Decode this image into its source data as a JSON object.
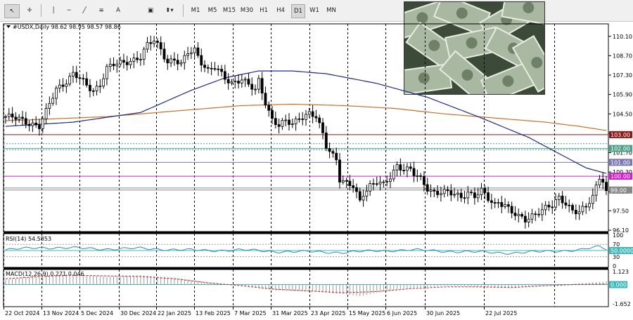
{
  "toolbar": {
    "timeframes": [
      "M1",
      "M5",
      "M15",
      "M30",
      "H1",
      "H4",
      "D1",
      "W1",
      "MN"
    ],
    "active": "D1"
  },
  "header": {
    "symbol": "#USDX,Daily",
    "ohlc": "98.62 98.95 98.57 98.86"
  },
  "photo": {
    "subject": "dollar-bills-photo"
  },
  "chart_data": [
    {
      "type": "candlestick",
      "ylim": [
        96.0,
        111.0
      ],
      "yticks": [
        "110.10",
        "108.70",
        "107.30",
        "105.90",
        "104.50",
        "103.10",
        "101.70",
        "100.30",
        "98.90",
        "97.50",
        "96.10"
      ],
      "xticks": [
        "22 Oct 2024",
        "13 Nov 2024",
        "5 Dec 2024",
        "30 Dec 2024",
        "22 Jan 2025",
        "13 Feb 2025",
        "7 Mar 2025",
        "31 Mar 2025",
        "23 Apr 2025",
        "15 May 2025",
        "6 Jun 2025",
        "30 Jun 2025",
        "22 Jul 2025"
      ],
      "close_path": [
        [
          0,
          104.3
        ],
        [
          4,
          104.1
        ],
        [
          8,
          103.8
        ],
        [
          10,
          103.6
        ],
        [
          12,
          104.6
        ],
        [
          15,
          106.3
        ],
        [
          18,
          106.9
        ],
        [
          20,
          107.4
        ],
        [
          22,
          107.0
        ],
        [
          24,
          106.5
        ],
        [
          26,
          106.2
        ],
        [
          28,
          106.7
        ],
        [
          30,
          107.8
        ],
        [
          32,
          108.0
        ],
        [
          35,
          108.2
        ],
        [
          37,
          108.4
        ],
        [
          40,
          108.6
        ],
        [
          42,
          109.4
        ],
        [
          44,
          109.8
        ],
        [
          46,
          109.2
        ],
        [
          48,
          108.3
        ],
        [
          50,
          108.4
        ],
        [
          52,
          108.0
        ],
        [
          54,
          108.9
        ],
        [
          56,
          109.2
        ],
        [
          58,
          108.3
        ],
        [
          60,
          107.6
        ],
        [
          62,
          107.8
        ],
        [
          65,
          107.1
        ],
        [
          67,
          106.8
        ],
        [
          70,
          107.0
        ],
        [
          72,
          106.5
        ],
        [
          74,
          106.2
        ],
        [
          75,
          106.9
        ],
        [
          77,
          105.4
        ],
        [
          79,
          104.1
        ],
        [
          81,
          103.6
        ],
        [
          83,
          103.9
        ],
        [
          85,
          103.8
        ],
        [
          87,
          104.3
        ],
        [
          90,
          104.5
        ],
        [
          92,
          104.2
        ],
        [
          94,
          103.0
        ],
        [
          95,
          102.2
        ],
        [
          96,
          101.9
        ],
        [
          98,
          101.3
        ],
        [
          99,
          99.8
        ],
        [
          101,
          99.4
        ],
        [
          103,
          99.2
        ],
        [
          105,
          98.2
        ],
        [
          106,
          98.8
        ],
        [
          108,
          99.4
        ],
        [
          110,
          99.6
        ],
        [
          112,
          99.3
        ],
        [
          114,
          99.9
        ],
        [
          116,
          100.8
        ],
        [
          118,
          100.6
        ],
        [
          120,
          100.5
        ],
        [
          121,
          100.1
        ],
        [
          123,
          99.7
        ],
        [
          125,
          99.1
        ],
        [
          127,
          98.9
        ],
        [
          129,
          98.9
        ],
        [
          131,
          98.8
        ],
        [
          133,
          98.6
        ],
        [
          135,
          98.5
        ],
        [
          137,
          98.9
        ],
        [
          139,
          98.6
        ],
        [
          141,
          98.9
        ],
        [
          143,
          98.3
        ],
        [
          145,
          97.9
        ],
        [
          146,
          98.2
        ],
        [
          148,
          98.0
        ],
        [
          150,
          97.4
        ],
        [
          152,
          97.0
        ],
        [
          154,
          96.8
        ],
        [
          156,
          97.2
        ],
        [
          158,
          97.5
        ],
        [
          160,
          97.7
        ],
        [
          162,
          97.8
        ],
        [
          164,
          98.4
        ],
        [
          166,
          98.1
        ],
        [
          168,
          97.6
        ],
        [
          170,
          97.4
        ],
        [
          172,
          97.7
        ],
        [
          174,
          98.5
        ],
        [
          176,
          100.0
        ],
        [
          177,
          99.8
        ],
        [
          178,
          98.9
        ]
      ],
      "ma_blue": [
        [
          0,
          103.6
        ],
        [
          20,
          103.9
        ],
        [
          40,
          104.6
        ],
        [
          55,
          106.2
        ],
        [
          65,
          107.1
        ],
        [
          75,
          107.6
        ],
        [
          85,
          107.6
        ],
        [
          95,
          107.4
        ],
        [
          110,
          106.7
        ],
        [
          125,
          105.7
        ],
        [
          140,
          104.3
        ],
        [
          155,
          102.8
        ],
        [
          165,
          101.5
        ],
        [
          172,
          100.6
        ],
        [
          178,
          100.2
        ]
      ],
      "ma_orange": [
        [
          0,
          104.0
        ],
        [
          30,
          104.3
        ],
        [
          50,
          104.7
        ],
        [
          70,
          105.1
        ],
        [
          85,
          105.2
        ],
        [
          100,
          105.1
        ],
        [
          115,
          104.9
        ],
        [
          130,
          104.5
        ],
        [
          145,
          104.2
        ],
        [
          160,
          103.9
        ],
        [
          170,
          103.6
        ],
        [
          178,
          103.3
        ]
      ],
      "levels": [
        {
          "value": 103.0,
          "label": "103.00",
          "color": "#8b1a1a"
        },
        {
          "value": 102.0,
          "label": "102.00",
          "color": "#4fa08a"
        },
        {
          "value": 101.0,
          "label": "101.00",
          "color": "#7a7ab0"
        },
        {
          "value": 100.0,
          "label": "100.00",
          "color": "#d020d0"
        },
        {
          "value": 99.0,
          "label": "99.00",
          "color": "#888888"
        }
      ]
    },
    {
      "type": "line",
      "title": "RSI(14) 54.5853",
      "ylim": [
        0,
        100
      ],
      "yticks": [
        "100",
        "70",
        "50",
        "30",
        "0"
      ],
      "level_label": "50.0000",
      "values": [
        [
          0,
          52
        ],
        [
          10,
          60
        ],
        [
          20,
          58
        ],
        [
          30,
          55
        ],
        [
          40,
          57
        ],
        [
          50,
          53
        ],
        [
          60,
          50
        ],
        [
          70,
          52
        ],
        [
          80,
          47
        ],
        [
          90,
          46
        ],
        [
          100,
          44
        ],
        [
          110,
          49
        ],
        [
          120,
          52
        ],
        [
          130,
          48
        ],
        [
          140,
          45
        ],
        [
          150,
          42
        ],
        [
          160,
          47
        ],
        [
          170,
          52
        ],
        [
          176,
          62
        ],
        [
          178,
          55
        ]
      ]
    },
    {
      "type": "histogram",
      "title": "MACD(12,26,9) 0.271 0.046",
      "ylim": [
        -1.9,
        1.3
      ],
      "yticks": [
        "1.123",
        "0.000",
        "-1.652"
      ],
      "level_label": "0.000",
      "values": [
        [
          0,
          0.4
        ],
        [
          10,
          0.8
        ],
        [
          20,
          0.9
        ],
        [
          30,
          0.7
        ],
        [
          40,
          0.8
        ],
        [
          50,
          0.6
        ],
        [
          60,
          0.2
        ],
        [
          70,
          -0.1
        ],
        [
          80,
          -0.5
        ],
        [
          90,
          -0.6
        ],
        [
          100,
          -0.8
        ],
        [
          105,
          -1.0
        ],
        [
          110,
          -0.7
        ],
        [
          120,
          -0.3
        ],
        [
          130,
          -0.1
        ],
        [
          140,
          -0.2
        ],
        [
          150,
          -0.3
        ],
        [
          160,
          -0.1
        ],
        [
          170,
          0.1
        ],
        [
          178,
          0.27
        ]
      ],
      "signal": [
        [
          0,
          0.5
        ],
        [
          10,
          0.7
        ],
        [
          20,
          0.8
        ],
        [
          30,
          0.75
        ],
        [
          40,
          0.7
        ],
        [
          50,
          0.5
        ],
        [
          60,
          0.15
        ],
        [
          70,
          -0.1
        ],
        [
          80,
          -0.4
        ],
        [
          90,
          -0.55
        ],
        [
          100,
          -0.7
        ],
        [
          110,
          -0.6
        ],
        [
          120,
          -0.35
        ],
        [
          130,
          -0.2
        ],
        [
          140,
          -0.2
        ],
        [
          150,
          -0.25
        ],
        [
          160,
          -0.1
        ],
        [
          170,
          0.02
        ],
        [
          178,
          0.05
        ]
      ]
    }
  ]
}
